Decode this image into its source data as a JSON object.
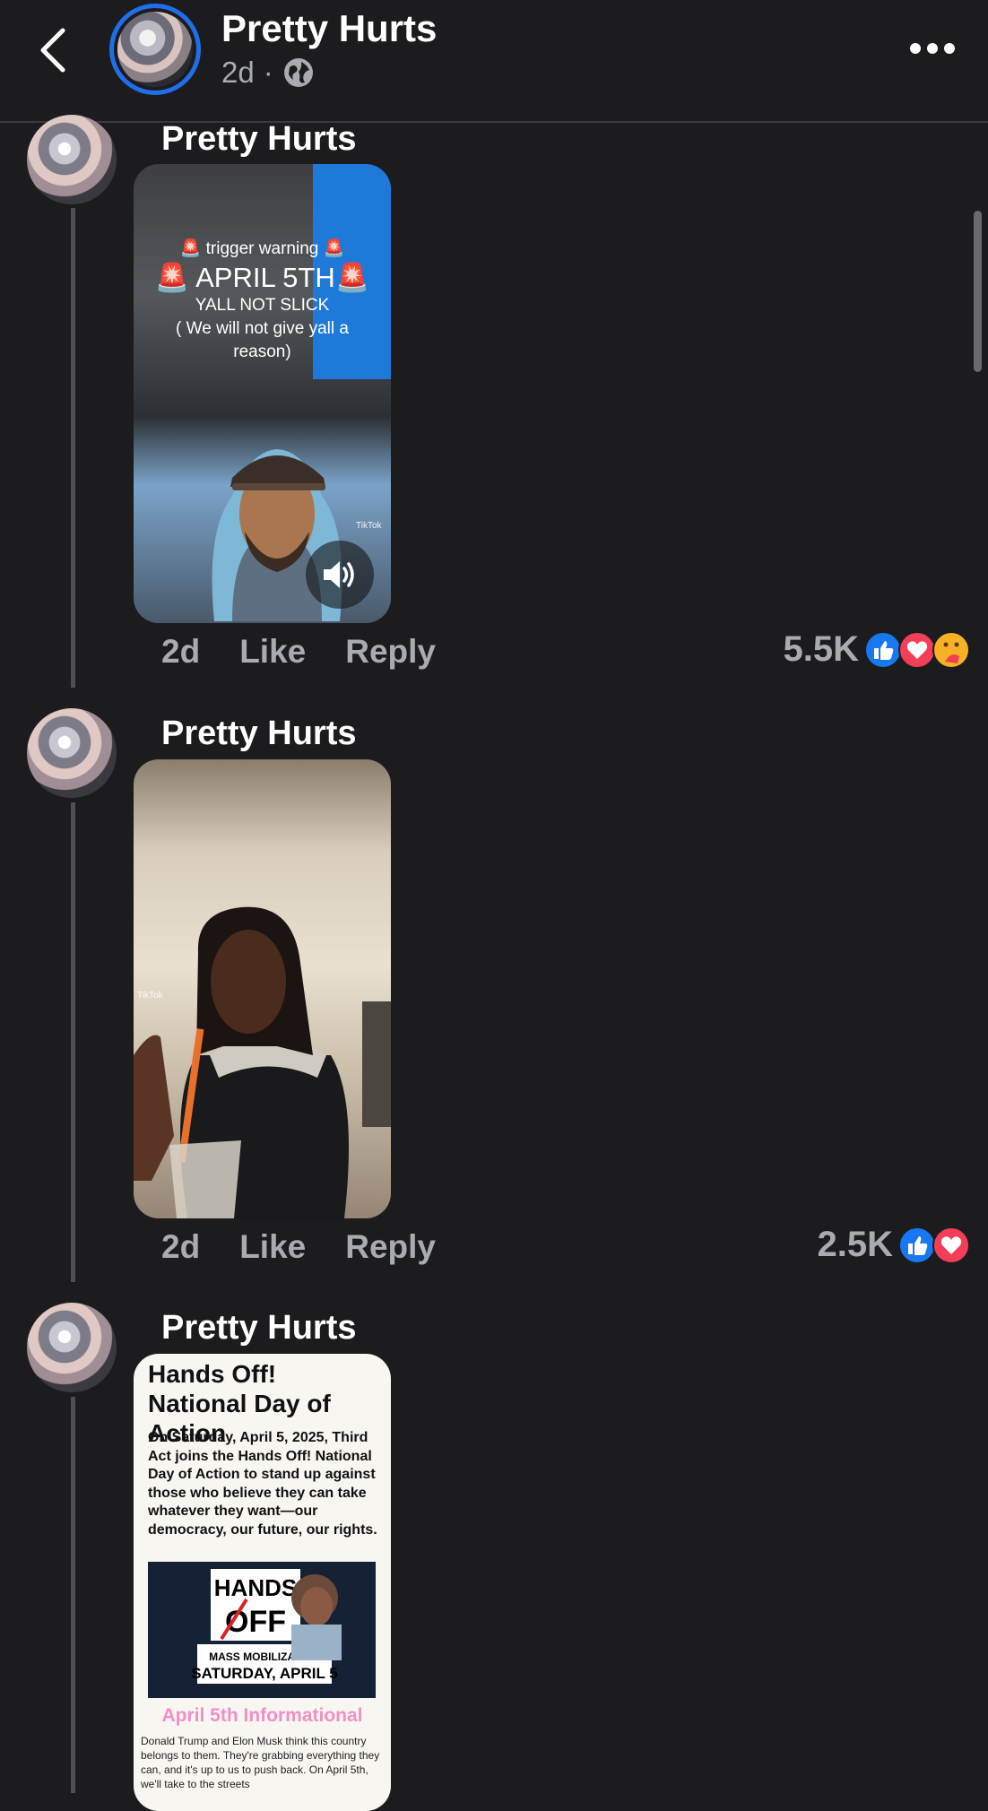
{
  "header": {
    "title": "Pretty Hurts",
    "time": "2d",
    "separator": "·"
  },
  "comments": [
    {
      "author": "Pretty Hurts",
      "time": "2d",
      "like_label": "Like",
      "reply_label": "Reply",
      "reaction_count": "5.5K",
      "reactions": [
        "like",
        "love",
        "care"
      ],
      "video_overlay": {
        "warning": "🚨 trigger warning 🚨",
        "date": "🚨 APRIL 5TH🚨",
        "line1": "YALL NOT SLICK",
        "line2": "( We will not give yall a",
        "line3": "reason)",
        "watermark": "TikTok"
      }
    },
    {
      "author": "Pretty Hurts",
      "time": "2d",
      "like_label": "Like",
      "reply_label": "Reply",
      "reaction_count": "2.5K",
      "reactions": [
        "like",
        "love"
      ],
      "video_overlay": {
        "watermark": "TikTok"
      }
    },
    {
      "author": "Pretty Hurts",
      "doc": {
        "title": "Hands Off! National Day of Action",
        "body": "On Saturday, April 5, 2025, Third Act joins the Hands Off! National Day of Action to stand up against those who believe they can take whatever they want—our democracy, our future, our rights.",
        "poster_top": "HANDS",
        "poster_mid": "OFF",
        "poster_line1": "MASS MOBILIZATION",
        "poster_line2": "SATURDAY, APRIL 5",
        "subtitle": "April 5th Informational",
        "small_text": "Donald Trump and Elon Musk think this country belongs to them. They're grabbing everything they can, and it's up to us to push back. On April 5th, we'll take to the streets"
      }
    }
  ],
  "colors": {
    "background": "#1c1c1e",
    "accent": "#1f6feb",
    "like": "#1877f2",
    "love": "#f33e58",
    "care": "#f7b125"
  }
}
